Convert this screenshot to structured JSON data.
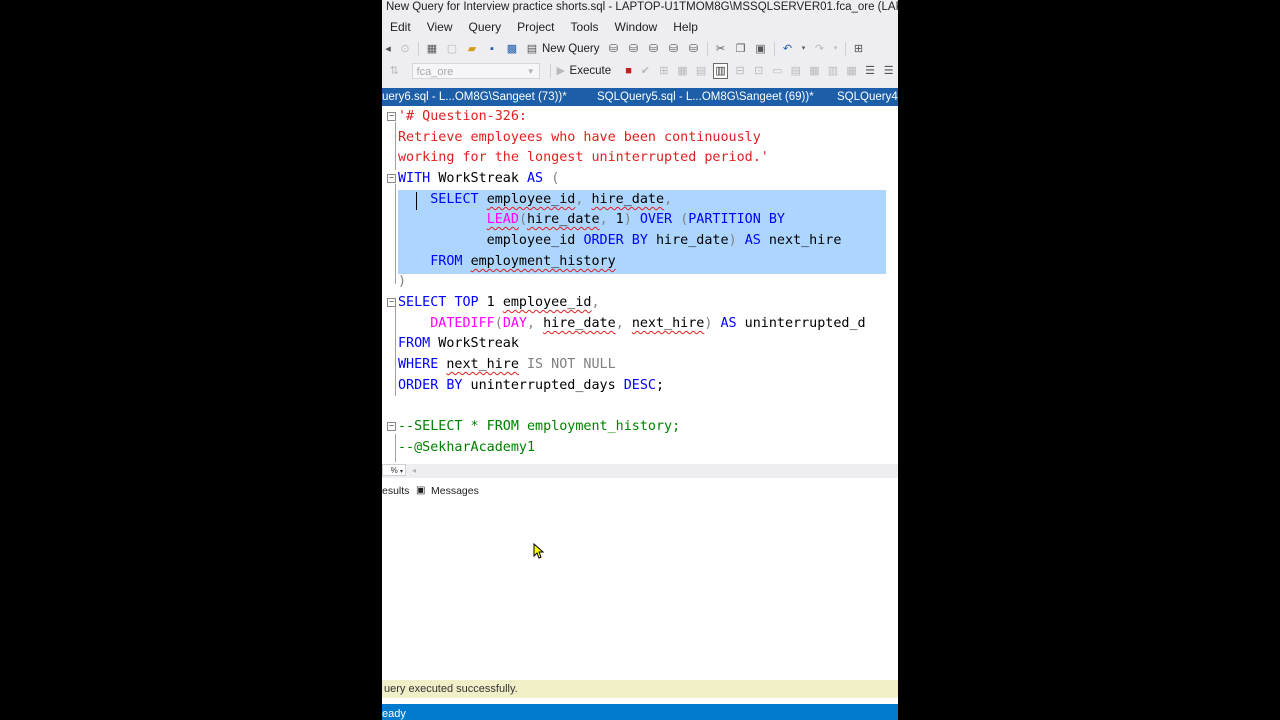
{
  "window": {
    "title": "New Query for Interview practice shorts.sql - LAPTOP-U1TMOM8G\\MSSQLSERVER01.fca_ore (LAPTOP-U1TMOM8G"
  },
  "menu": [
    "Edit",
    "View",
    "Query",
    "Project",
    "Tools",
    "Window",
    "Help"
  ],
  "toolbar": {
    "new_query_label": "New Query",
    "database": "fca_ore",
    "execute_label": "Execute"
  },
  "tabs": [
    {
      "label": "uery6.sql - L...OM8G\\Sangeet (73))*"
    },
    {
      "label": "SQLQuery5.sql - L...OM8G\\Sangeet (69))*"
    },
    {
      "label": "SQLQuery4.s"
    }
  ],
  "editor": {
    "lines": [
      "'# Question-326:",
      "Retrieve employees who have been continuously",
      "working for the longest uninterrupted period.'",
      "WITH WorkStreak AS (",
      "    SELECT employee_id, hire_date,",
      "           LEAD(hire_date, 1) OVER (PARTITION BY",
      "           employee_id ORDER BY hire_date) AS next_hire",
      "    FROM employment_history",
      ")",
      "SELECT TOP 1 employee_id,",
      "    DATEDIFF(DAY, hire_date, next_hire) AS uninterrupted_d",
      "FROM WorkStreak",
      "WHERE next_hire IS NOT NULL",
      "ORDER BY uninterrupted_days DESC;",
      "",
      "--SELECT * FROM employment_history;",
      "--@SekharAcademy1"
    ]
  },
  "zoom": "%",
  "results_tabs": {
    "results_label": "esults",
    "messages_label": "Messages"
  },
  "status_message": "uery executed successfully.",
  "status_bar": "eady",
  "colors": {
    "keyword": "#0000ff",
    "string": "#e02020",
    "function": "#ff00ff",
    "comment": "#008000",
    "selection": "#add6ff",
    "tab_strip": "#1c5ea8",
    "status_bar": "#007acc"
  }
}
